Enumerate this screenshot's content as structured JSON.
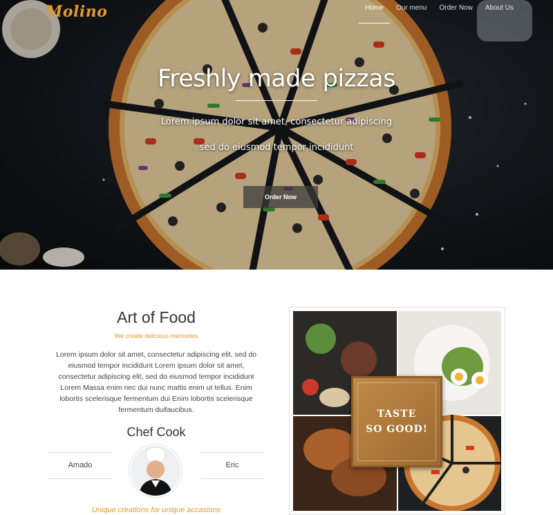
{
  "brand": {
    "logo": "Molino"
  },
  "nav": {
    "items": [
      {
        "label": "Home",
        "active": true
      },
      {
        "label": "Our menu",
        "active": false
      },
      {
        "label": "Order Now",
        "active": false
      },
      {
        "label": "About Us",
        "active": false
      }
    ]
  },
  "hero": {
    "title": "Freshly made pizzas",
    "subtitle_line1": "Lorem ipsum dolor sit amet, consectetur adipiscing",
    "subtitle_line2": "sed do eiusmod tempor incididunt",
    "button_label": "Order Now"
  },
  "about": {
    "title": "Art of Food",
    "tagline": "We create delicious memories",
    "body": "Lorem ipsum dolor sit amet, consectetur adipiscing elit, sed do eiusmod tempor incididunt Lorem ipsum dolor sit amet, consectetur adipiscing elit, sed do eiusmod tempor incididunt Lorem Massa enim nec dui nunc mattis enim ut tellus. Enim lobortis scelerisque fermentum dui Enim lobortis scelerisque fermentum duifaucibus."
  },
  "chefs": {
    "title": "Chef Cook",
    "left_name": "Amado",
    "right_name": "Eric",
    "footer_tagline": "Unique creations for unique accasions"
  },
  "promo": {
    "line1": "TASTE",
    "line2": "SO GOOD!"
  },
  "colors": {
    "accent": "#e29a2d",
    "hero_bg": "#15181c"
  },
  "icons": {
    "avatar": "chef-photo"
  }
}
